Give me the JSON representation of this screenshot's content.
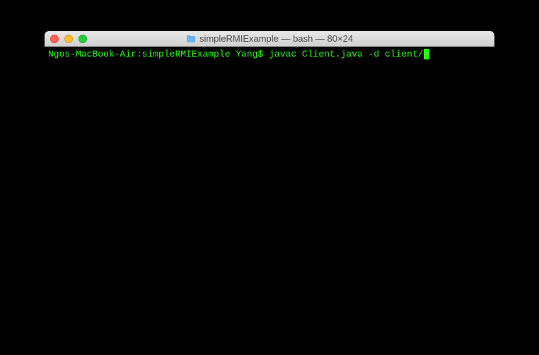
{
  "window": {
    "title": "simpleRMIExample — bash — 80×24"
  },
  "terminal": {
    "prompt": {
      "host": "Ngos-MacBook-Air",
      "path": "simpleRMIExample",
      "user": "Yang",
      "separator1": ":",
      "separator2": " ",
      "dollar": "$"
    },
    "command": "javac Client.java -d client/"
  }
}
